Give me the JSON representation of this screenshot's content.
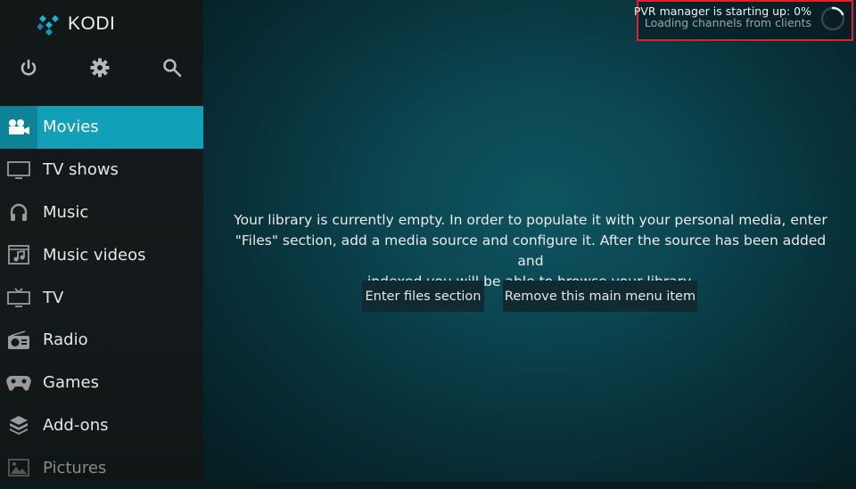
{
  "app": {
    "name": "KODI"
  },
  "top_icons": [
    {
      "name": "power-icon",
      "label": "Power"
    },
    {
      "name": "settings-icon",
      "label": "Settings"
    },
    {
      "name": "search-icon",
      "label": "Search"
    }
  ],
  "sidebar": {
    "items": [
      {
        "label": "Movies",
        "icon": "movie-camera-icon",
        "active": true
      },
      {
        "label": "TV shows",
        "icon": "monitor-icon"
      },
      {
        "label": "Music",
        "icon": "headphones-icon"
      },
      {
        "label": "Music videos",
        "icon": "music-video-icon"
      },
      {
        "label": "TV",
        "icon": "tv-icon"
      },
      {
        "label": "Radio",
        "icon": "radio-icon"
      },
      {
        "label": "Games",
        "icon": "gamepad-icon"
      },
      {
        "label": "Add-ons",
        "icon": "addons-box-icon"
      },
      {
        "label": "Pictures",
        "icon": "picture-icon"
      }
    ]
  },
  "notification": {
    "title": "PVR manager is starting up: 0%",
    "subtitle": "Loading channels from clients",
    "progress_percent": 0,
    "highlight_color": "#e0202a"
  },
  "main": {
    "message_lines": [
      "Your library is currently empty. In order to populate it with your personal media, enter",
      "\"Files\" section, add a media source and configure it. After the source has been added and",
      "indexed you will be able to browse your library."
    ],
    "buttons": {
      "enter_files": "Enter files section",
      "remove_item": "Remove this main menu item"
    }
  },
  "colors": {
    "accent": "#12a0b8",
    "accent_dark": "#0e8398",
    "sidebar_bg": "#141a1b",
    "main_bg": "#0b4550"
  }
}
